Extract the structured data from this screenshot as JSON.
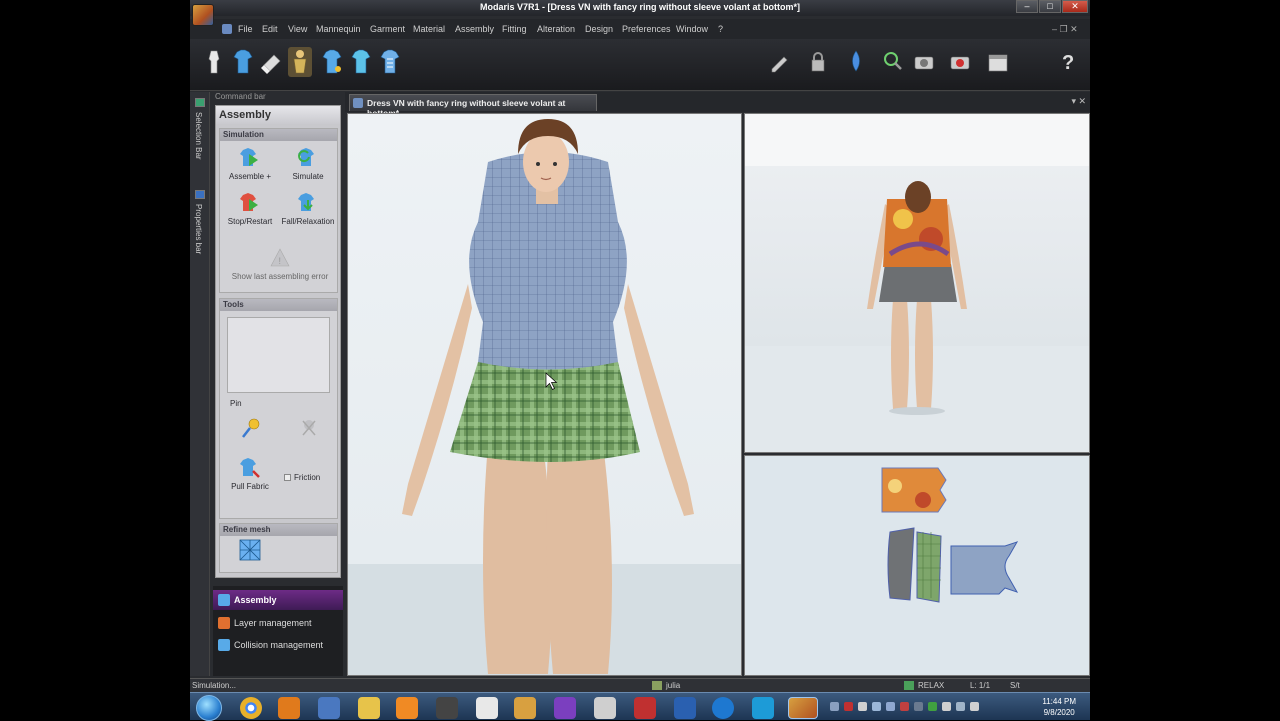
{
  "window": {
    "title": "Modaris V7R1 - [Dress VN with fancy ring without sleeve volant at bottom*]",
    "min": "–",
    "max": "□",
    "close": "✕"
  },
  "menu": [
    "File",
    "Edit",
    "View",
    "Mannequin",
    "Garment",
    "Material",
    "Assembly",
    "Fitting",
    "Alteration",
    "Design",
    "Preferences",
    "Window",
    "?"
  ],
  "mdi_controls": "–  ❐  ✕",
  "toolbar": {
    "left_icons": [
      "mannequin-icon",
      "shirt-icon",
      "eraser-icon",
      "dress-form-icon",
      "shirt-blue-icon",
      "shirt-cyan-icon",
      "shirt-pattern-icon"
    ],
    "right_icons": [
      "pen-icon",
      "lock-icon",
      "drop-icon",
      "zoom-icon",
      "camera-icon",
      "record-icon",
      "window-icon",
      "help-icon"
    ]
  },
  "sidebar_strip": {
    "selection_bar": "Selection Bar",
    "properties_bar": "Properties bar"
  },
  "command_bar": {
    "header": "Command bar",
    "title": "Assembly",
    "simulation": {
      "heading": "Simulation",
      "assemble": "Assemble +",
      "simulate": "Simulate",
      "stop_restart": "Stop/Restart",
      "fall_relaxation": "Fall/Relaxation",
      "show_error": "Show last assembling error"
    },
    "tools": {
      "heading": "Tools",
      "pin": "Pin",
      "pull_fabric": "Pull Fabric",
      "friction": "Friction"
    },
    "refine": {
      "heading": "Refine mesh"
    },
    "tabs": {
      "assembly": "Assembly",
      "layer_management": "Layer management",
      "collision_management": "Collision management"
    }
  },
  "document": {
    "tab_label": "Dress VN with fancy ring without sleeve volant at bottom*",
    "controls": "▾ ✕"
  },
  "statusbar": {
    "left": "Simulation...",
    "user": "julia",
    "mode": "RELAX",
    "layer": "L: 1/1",
    "s": "S/t"
  },
  "taskbar": {
    "time": "11:44 PM",
    "date": "9/8/2020",
    "colors": {
      "chrome": "#e8b02a",
      "outlook": "#e07a1c",
      "explorer": "#e7c34a",
      "media": "#f08a24",
      "skype": "#1d9bd7",
      "vs": "#7b3fbf"
    }
  },
  "colors": {
    "active_tab": "#6d2b86",
    "fabric_blue": "#8ea3c4",
    "skirt_green": "#6f9a5e",
    "skin": "#e3c1a4"
  }
}
